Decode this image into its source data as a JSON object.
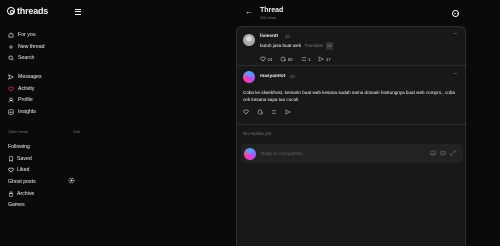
{
  "app": {
    "name": "threads"
  },
  "sidebar": {
    "nav": [
      {
        "label": "For you",
        "icon": "home-icon"
      },
      {
        "label": "New thread",
        "icon": "plus-icon"
      },
      {
        "label": "Search",
        "icon": "search-icon"
      },
      {
        "label": "Messages",
        "icon": "send-icon"
      },
      {
        "label": "Activity",
        "icon": "heart-icon"
      },
      {
        "label": "Profile",
        "icon": "user-icon"
      },
      {
        "label": "Insights",
        "icon": "chart-icon"
      }
    ],
    "feeds_header": {
      "title": "Other feeds",
      "edit": "Edit"
    },
    "feeds": [
      {
        "label": "Following",
        "icon": ""
      },
      {
        "label": "Saved",
        "icon": "bookmark-icon"
      },
      {
        "label": "Liked",
        "icon": "heart-icon"
      },
      {
        "label": "Ghost posts",
        "icon": ""
      },
      {
        "label": "Archive",
        "icon": "lock-icon"
      },
      {
        "label": "Games",
        "icon": ""
      }
    ]
  },
  "header": {
    "title": "Thread",
    "subtitle": "336 views"
  },
  "original_post": {
    "username": "liviesntt",
    "time": "4h",
    "text": "butuh jasa buat web",
    "translate": "Translate",
    "badge": "1/2",
    "likes": "24",
    "comments": "50",
    "reposts": "1",
    "shares": "17"
  },
  "reply_post": {
    "username": "masyamtot",
    "time": "3h",
    "text": "Coba ke idwebhost, kemarin buat web kesana sudah sama domain hostungnya buat web compro,, coba cek kesana sapa tau cocok"
  },
  "no_replies": "No replies yet",
  "reply_input": {
    "placeholder": "Reply to masyamtot..."
  },
  "colors": {
    "background": "#0a0a0a",
    "panel": "#181818",
    "border": "#2d2d2d",
    "muted": "#777777"
  }
}
